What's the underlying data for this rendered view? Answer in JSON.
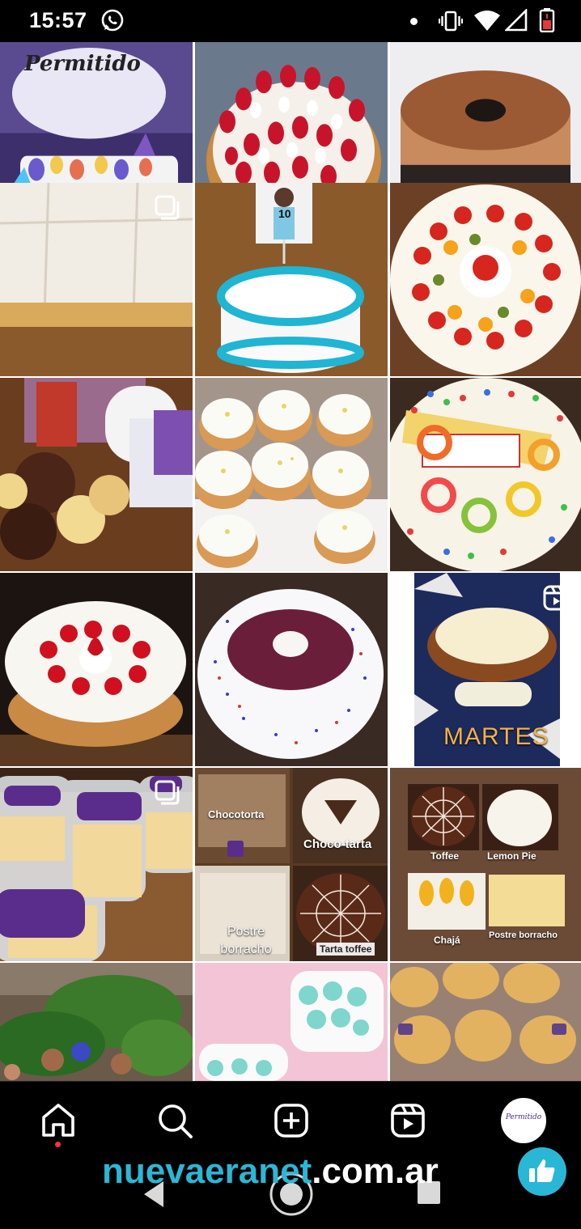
{
  "status_bar": {
    "time": "15:57",
    "icons": [
      "whatsapp-icon",
      "notification-dot",
      "vibrate-icon",
      "wifi-icon",
      "cellular-icon",
      "battery-icon"
    ]
  },
  "grid": {
    "tiles": [
      {
        "id": "t1",
        "caption": "Permitido",
        "multi": false,
        "reel": false
      },
      {
        "id": "t2",
        "caption": "",
        "multi": false,
        "reel": false
      },
      {
        "id": "t3",
        "caption": "",
        "multi": false,
        "reel": false
      },
      {
        "id": "t4",
        "caption": "",
        "multi": true,
        "reel": false
      },
      {
        "id": "t5",
        "caption": "10",
        "multi": false,
        "reel": false
      },
      {
        "id": "t6",
        "caption": "",
        "multi": false,
        "reel": false
      },
      {
        "id": "t7",
        "caption": "",
        "multi": false,
        "reel": false
      },
      {
        "id": "t8",
        "caption": "",
        "multi": false,
        "reel": false
      },
      {
        "id": "t9",
        "caption": "",
        "multi": false,
        "reel": false
      },
      {
        "id": "t10",
        "caption": "",
        "multi": false,
        "reel": false
      },
      {
        "id": "t11",
        "caption": "",
        "multi": false,
        "reel": false
      },
      {
        "id": "t12",
        "caption": "MARTES",
        "multi": false,
        "reel": true
      },
      {
        "id": "t13",
        "caption": "",
        "multi": true,
        "reel": false
      },
      {
        "id": "t14",
        "caption": "",
        "multi": false,
        "reel": false
      },
      {
        "id": "t15",
        "caption": "",
        "multi": false,
        "reel": false
      },
      {
        "id": "t16",
        "caption": "",
        "multi": false,
        "reel": false
      },
      {
        "id": "t17",
        "caption": "",
        "multi": false,
        "reel": false
      },
      {
        "id": "t18",
        "caption": "",
        "multi": false,
        "reel": false
      }
    ],
    "collage_1": {
      "chocotorta": "Chocotorta",
      "chocotarta": "Choco-tarta",
      "postre_borracho": "Postre borracho",
      "tarta_toffee": "Tarta toffee"
    },
    "collage_2": {
      "toffee": "Toffee",
      "lemon_pie": "Lemon Pie",
      "chaja": "Chajá",
      "postre_borracho": "Postre borracho"
    }
  },
  "bottom_nav": {
    "items": [
      "home-icon",
      "search-icon",
      "create-icon",
      "reels-icon",
      "profile-avatar"
    ],
    "avatar_text": "Permitido"
  },
  "watermark": {
    "part1": "nuevaeranet",
    "part2": ".com.ar"
  },
  "colors": {
    "accent": "#2ab7d6",
    "notification": "#ff3040",
    "background": "#000000"
  }
}
